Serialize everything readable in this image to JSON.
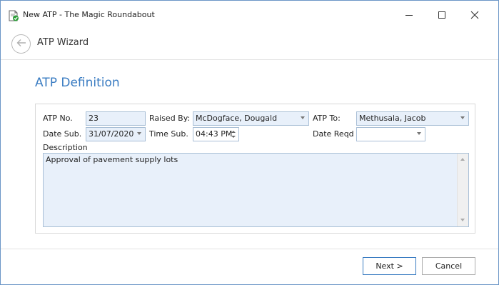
{
  "window": {
    "title": "New ATP - The Magic Roundabout"
  },
  "wizard": {
    "title": "ATP Wizard"
  },
  "page": {
    "title": "ATP Definition"
  },
  "form": {
    "atp_no_label": "ATP No.",
    "atp_no_value": "23",
    "raised_by_label": "Raised By:",
    "raised_by_value": "McDogface, Dougald",
    "atp_to_label": "ATP To:",
    "atp_to_value": "Methusala, Jacob",
    "date_sub_label": "Date Sub.",
    "date_sub_value": "31/07/2020",
    "time_sub_label": "Time Sub.",
    "time_sub_value": "04:43 PM",
    "date_reqd_label": "Date Reqd",
    "date_reqd_value": "",
    "description_label": "Description",
    "description_value": "Approval of pavement supply lots"
  },
  "footer": {
    "next_label": "Next >",
    "cancel_label": "Cancel"
  },
  "colors": {
    "accent": "#3a7cc2",
    "field_bg": "#e8f0fa",
    "field_border": "#a9bfd6"
  },
  "icons": {
    "app": "document-check-icon",
    "back": "back-arrow-icon",
    "minimize": "minimize-icon",
    "maximize": "maximize-icon",
    "close": "close-icon"
  }
}
